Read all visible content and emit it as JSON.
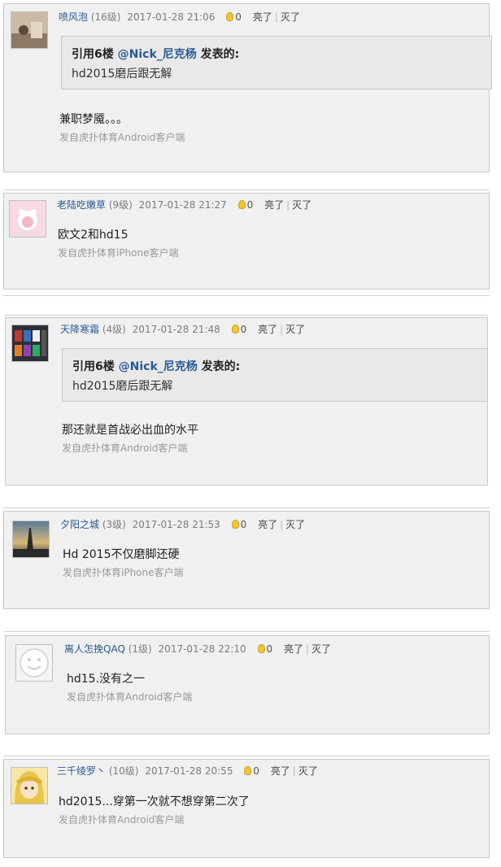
{
  "posts": [
    {
      "user": "喷风泡",
      "level": "(16级)",
      "time": "2017-01-28 21:06",
      "likes": "0",
      "like_label": "亮了",
      "sep": "|",
      "dislike_label": "灭了",
      "quote": {
        "prefix": "引用6楼",
        "user": "@Nick_尼克杨",
        "suffix": "发表的:",
        "text": "hd2015磨后跟无解"
      },
      "content": "兼职梦魇。。。",
      "source": "发自虎扑体育Android客户端"
    },
    {
      "user": "老陆吃嫩草",
      "level": "(9级)",
      "time": "2017-01-28 21:27",
      "likes": "0",
      "like_label": "亮了",
      "sep": "|",
      "dislike_label": "灭了",
      "content": "欧文2和hd15",
      "source": "发自虎扑体育iPhone客户端"
    },
    {
      "user": "天降寒霜",
      "level": "(4级)",
      "time": "2017-01-28 21:48",
      "likes": "0",
      "like_label": "亮了",
      "sep": "|",
      "dislike_label": "灭了",
      "quote": {
        "prefix": "引用6楼",
        "user": "@Nick_尼克杨",
        "suffix": "发表的:",
        "text": "hd2015磨后跟无解"
      },
      "content": "那还就是首战必出血的水平",
      "source": "发自虎扑体育Android客户端"
    },
    {
      "user": "夕阳之城",
      "level": "(3级)",
      "time": "2017-01-28 21:53",
      "likes": "0",
      "like_label": "亮了",
      "sep": "|",
      "dislike_label": "灭了",
      "content": "Hd 2015不仅磨脚还硬",
      "source": "发自虎扑体育iPhone客户端"
    },
    {
      "user": "离人怎挽QAQ",
      "level": "(1级)",
      "time": "2017-01-28 22:10",
      "likes": "0",
      "like_label": "亮了",
      "sep": "|",
      "dislike_label": "灭了",
      "content": "hd15.没有之一",
      "source": "发自虎扑体育Android客户端"
    },
    {
      "user": "三千绫罗丶",
      "level": "(10级)",
      "time": "2017-01-28 20:55",
      "likes": "0",
      "like_label": "亮了",
      "sep": "|",
      "dislike_label": "灭了",
      "content": "hd2015...穿第一次就不想穿第二次了",
      "source": "发自虎扑体育Android客户端"
    }
  ]
}
